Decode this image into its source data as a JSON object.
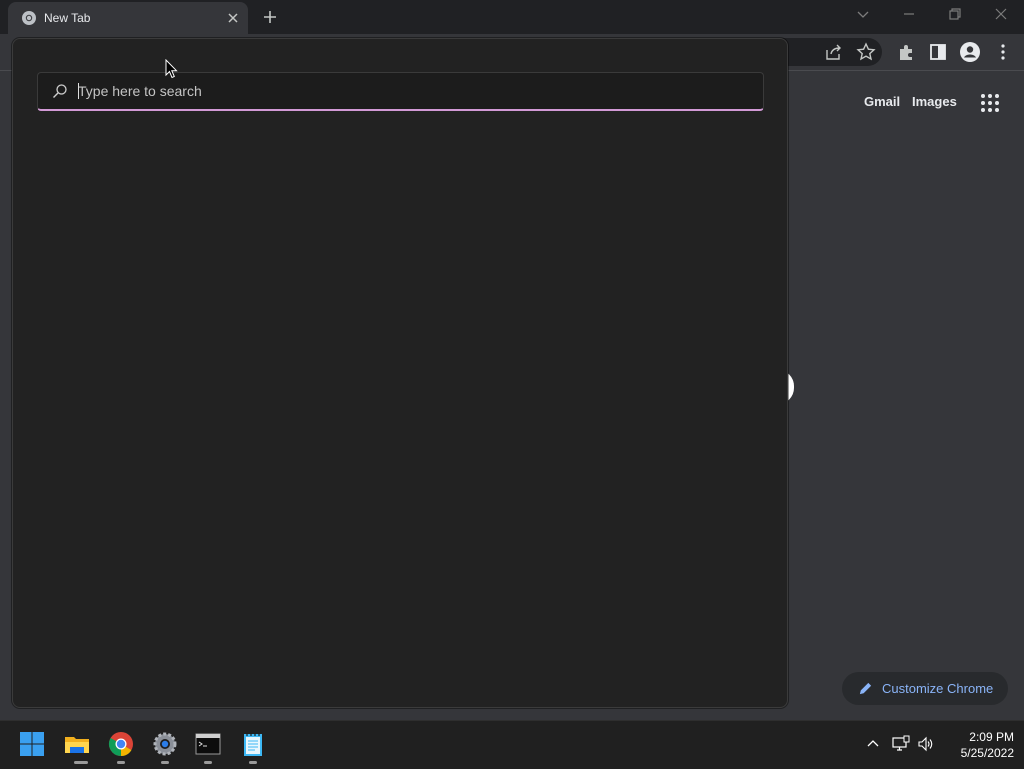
{
  "browser": {
    "tab": {
      "title": "New Tab"
    },
    "toolbar_icons": [
      "share-icon",
      "bookmark-star-icon",
      "extensions-icon",
      "side-panel-icon",
      "profile-icon",
      "menu-icon"
    ]
  },
  "ntp": {
    "links": {
      "gmail": "Gmail",
      "images": "Images"
    },
    "customize_label": "Customize Chrome",
    "accent": "#8ab4f8"
  },
  "search_popup": {
    "placeholder": "Type here to search",
    "value": "",
    "accent": "#d29ad6"
  },
  "taskbar": {
    "apps": [
      "start-icon",
      "file-explorer-icon",
      "chrome-icon",
      "settings-icon",
      "terminal-icon",
      "notepad-icon"
    ],
    "tray": [
      "chevron-up-icon",
      "network-icon",
      "volume-icon"
    ],
    "clock": {
      "time": "2:09 PM",
      "date": "5/25/2022"
    }
  }
}
